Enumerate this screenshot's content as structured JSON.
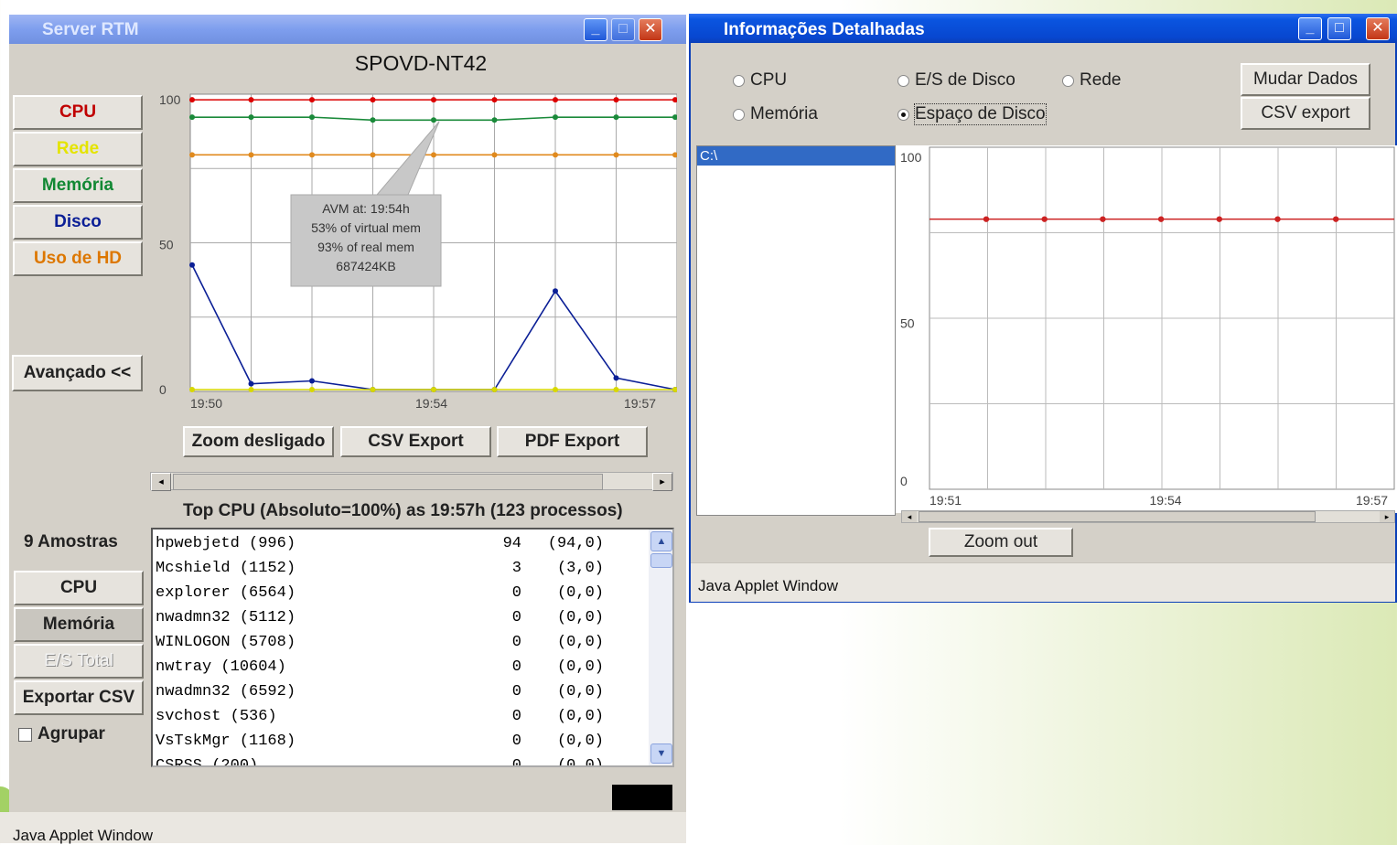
{
  "left_window": {
    "title": "Server RTM",
    "host": "SPOVD-NT42",
    "metric_buttons": [
      {
        "label": "CPU",
        "color": "#c00000"
      },
      {
        "label": "Rede",
        "color": "#e4e400"
      },
      {
        "label": "Memória",
        "color": "#118833"
      },
      {
        "label": "Disco",
        "color": "#0b1f96"
      },
      {
        "label": "Uso de HD",
        "color": "#dd7700"
      }
    ],
    "advanced_button": "Avançado <<",
    "tooltip": [
      "AVM at: 19:54h",
      "53% of virtual mem",
      "93% of real mem",
      "687424KB"
    ],
    "chart_buttons": [
      "Zoom desligado",
      "CSV Export",
      "PDF Export"
    ],
    "top_cpu_title": "Top CPU (Absoluto=100%) as 19:57h (123 processos)",
    "samples": "9 Amostras",
    "sort_buttons": [
      "CPU",
      "Memória",
      "E/S Total",
      "Exportar CSV"
    ],
    "group_label": "Agrupar",
    "processes": [
      {
        "name": "hpwebjetd (996)",
        "value": "94",
        "detail": "(94,0)"
      },
      {
        "name": "Mcshield (1152)",
        "value": "3",
        "detail": "(3,0)"
      },
      {
        "name": "explorer (6564)",
        "value": "0",
        "detail": "(0,0)"
      },
      {
        "name": "nwadmn32 (5112)",
        "value": "0",
        "detail": "(0,0)"
      },
      {
        "name": "WINLOGON (5708)",
        "value": "0",
        "detail": "(0,0)"
      },
      {
        "name": "nwtray (10604)",
        "value": "0",
        "detail": "(0,0)"
      },
      {
        "name": "nwadmn32 (6592)",
        "value": "0",
        "detail": "(0,0)"
      },
      {
        "name": "svchost (536)",
        "value": "0",
        "detail": "(0,0)"
      },
      {
        "name": "VsTskMgr (1168)",
        "value": "0",
        "detail": "(0,0)"
      },
      {
        "name": "CSRSS (200)",
        "value": "0",
        "detail": "(0,0)"
      }
    ],
    "status_bar": "Java Applet Window"
  },
  "right_window": {
    "title": "Informações Detalhadas",
    "radios": [
      {
        "label": "CPU",
        "checked": false
      },
      {
        "label": "E/S de Disco",
        "checked": false
      },
      {
        "label": "Rede",
        "checked": false
      },
      {
        "label": "Memória",
        "checked": false
      },
      {
        "label": "Espaço de Disco",
        "checked": true
      }
    ],
    "buttons": [
      "Mudar Dados",
      "CSV export"
    ],
    "drive_list": [
      "C:\\"
    ],
    "zoom_button": "Zoom out",
    "status_bar": "Java Applet Window"
  },
  "chart_data": [
    {
      "type": "line",
      "x": [
        "19:50",
        "19:51",
        "19:52",
        "19:53",
        "19:54",
        "19:55",
        "19:56",
        "19:57",
        "19:57"
      ],
      "xticks": [
        "19:50",
        "19:54",
        "19:57"
      ],
      "yticks": [
        "0",
        "50",
        "100"
      ],
      "ylim": [
        0,
        100
      ],
      "series": [
        {
          "color": "#dd0000",
          "values": [
            100,
            100,
            100,
            100,
            100,
            100,
            100,
            100,
            100
          ]
        },
        {
          "color": "#1a8a3a",
          "values": [
            94,
            94,
            94,
            93,
            93,
            93,
            94,
            94,
            94
          ]
        },
        {
          "color": "#e08a1e",
          "values": [
            81,
            81,
            81,
            81,
            81,
            81,
            81,
            81,
            81
          ]
        },
        {
          "color": "#0b1f96",
          "values": [
            43,
            2,
            3,
            0,
            0,
            0,
            34,
            4,
            0
          ]
        },
        {
          "color": "#d8d800",
          "values": [
            0,
            0,
            0,
            0,
            0,
            0,
            0,
            0,
            0
          ]
        }
      ]
    },
    {
      "type": "line",
      "xticks": [
        "19:51",
        "19:54",
        "19:57"
      ],
      "yticks": [
        "0",
        "50",
        "100"
      ],
      "ylim": [
        0,
        100
      ],
      "series": [
        {
          "color": "#cc2222",
          "values": [
            82,
            82,
            82,
            82,
            82,
            82,
            82
          ]
        }
      ]
    }
  ]
}
